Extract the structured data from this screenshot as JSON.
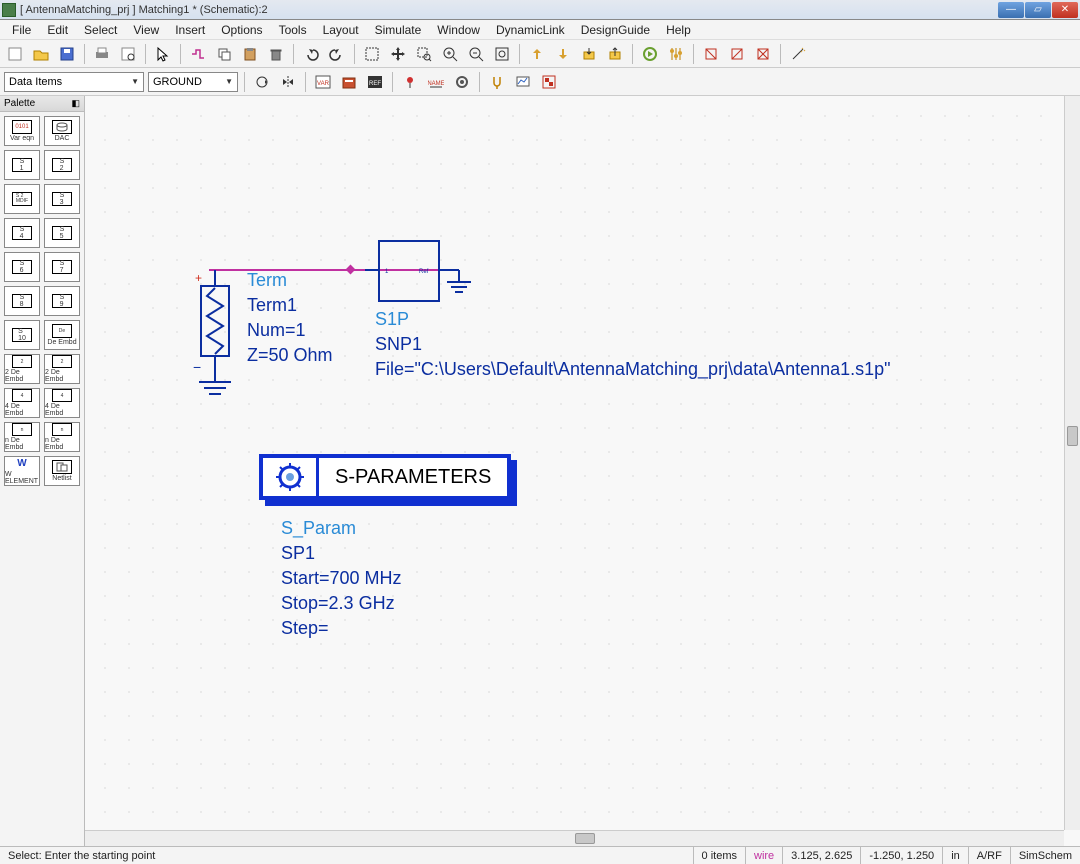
{
  "title": "[ AntennaMatching_prj ] Matching1 * (Schematic):2",
  "menu": [
    "File",
    "Edit",
    "Select",
    "View",
    "Insert",
    "Options",
    "Tools",
    "Layout",
    "Simulate",
    "Window",
    "DynamicLink",
    "DesignGuide",
    "Help"
  ],
  "combo1": "Data Items",
  "combo2": "GROUND",
  "palette_title": "Palette",
  "palette": [
    {
      "lbl": "Var eqn"
    },
    {
      "lbl": "DAC"
    },
    {
      "lbl": "S 1"
    },
    {
      "lbl": "S 2"
    },
    {
      "lbl": "S 2 MDIF"
    },
    {
      "lbl": "S 3"
    },
    {
      "lbl": "S 4"
    },
    {
      "lbl": "S 5"
    },
    {
      "lbl": "S 6"
    },
    {
      "lbl": "S 7"
    },
    {
      "lbl": "S 8"
    },
    {
      "lbl": "S 9"
    },
    {
      "lbl": "S 10"
    },
    {
      "lbl": "De Embd"
    },
    {
      "lbl": "2 De Embd"
    },
    {
      "lbl": "2 De Embd"
    },
    {
      "lbl": "4 De Embd"
    },
    {
      "lbl": "4 De Embd"
    },
    {
      "lbl": "n De Embd"
    },
    {
      "lbl": "n De Embd"
    },
    {
      "lbl": "W ELEMENT"
    },
    {
      "lbl": "Netlist"
    }
  ],
  "term": {
    "type": "Term",
    "name": "Term1",
    "num": "Num=1",
    "z": "Z=50 Ohm"
  },
  "snp": {
    "type": "S1P",
    "name": "SNP1",
    "file": "File=\"C:\\Users\\Default\\AntennaMatching_prj\\data\\Antenna1.s1p\""
  },
  "spblock": {
    "header": "S-PARAMETERS",
    "type": "S_Param",
    "name": "SP1",
    "start": "Start=700 MHz",
    "stop": "Stop=2.3 GHz",
    "step": "Step="
  },
  "snp_inner": {
    "port": "1",
    "ref": "Ref"
  },
  "status": {
    "hint": "Select: Enter the starting point",
    "items": "0 items",
    "mode": "wire",
    "coord1": "3.125, 2.625",
    "coord2": "-1.250, 1.250",
    "unit": "in",
    "tech": "A/RF",
    "ctx": "SimSchem"
  }
}
